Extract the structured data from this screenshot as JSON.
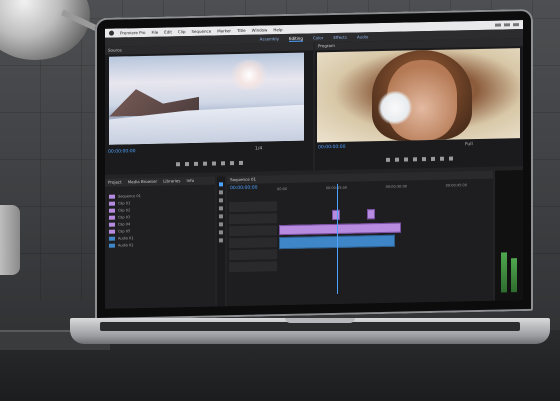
{
  "app": {
    "menubar": {
      "app_name": "Premiere Pro",
      "items": [
        "File",
        "Edit",
        "Clip",
        "Sequence",
        "Marker",
        "Title",
        "Window",
        "Help"
      ]
    },
    "workspaces": [
      {
        "label": "Assembly",
        "active": false
      },
      {
        "label": "Editing",
        "active": true
      },
      {
        "label": "Color",
        "active": false
      },
      {
        "label": "Effects",
        "active": false
      },
      {
        "label": "Audio",
        "active": false
      }
    ],
    "source_monitor": {
      "tab_label": "Source",
      "timecode": "00:00:00:00",
      "fraction": "1/4"
    },
    "program_monitor": {
      "tab_label": "Program",
      "timecode": "00:00:00:00",
      "fraction": "Full"
    },
    "project_panel": {
      "tabs": [
        "Project",
        "Media Browser",
        "Libraries",
        "Info"
      ],
      "rows": [
        {
          "name": "Sequence 01",
          "color": "#b78ce0"
        },
        {
          "name": "Clip 01",
          "color": "#b78ce0"
        },
        {
          "name": "Clip 02",
          "color": "#b78ce0"
        },
        {
          "name": "Clip 03",
          "color": "#b78ce0"
        },
        {
          "name": "Clip 04",
          "color": "#b78ce0"
        },
        {
          "name": "Clip 05",
          "color": "#b78ce0"
        },
        {
          "name": "Audio 01",
          "color": "#3f86c8"
        },
        {
          "name": "Audio 02",
          "color": "#3f86c8"
        }
      ]
    },
    "timeline": {
      "tabs": [
        "Sequence 01"
      ],
      "timecode": "00:00:00:00",
      "ruler": [
        "00:00",
        "00:00:15:00",
        "00:00:30:00",
        "00:00:45:00"
      ]
    }
  },
  "colors": {
    "accent": "#4ea2ff",
    "video_clip": "#b78ce0",
    "audio_clip": "#3f86c8"
  }
}
